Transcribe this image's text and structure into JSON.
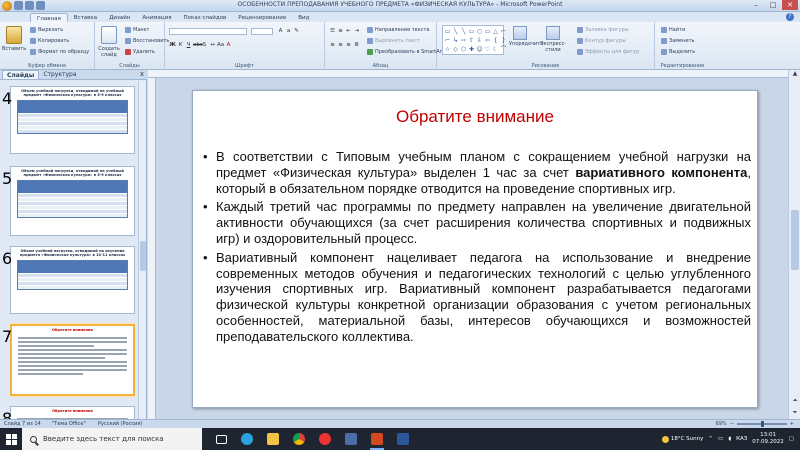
{
  "window": {
    "title": "ОСОБЕННОСТИ ПРЕПОДАВАНИЯ УЧЕБНОГО ПРЕДМЕТА «ФИЗИЧЕСКАЯ КУЛЬТУРА» - Microsoft PowerPoint",
    "minimize": "–",
    "maximize": "□",
    "close": "✕"
  },
  "tabs": [
    "Главная",
    "Вставка",
    "Дизайн",
    "Анимация",
    "Показ слайдов",
    "Рецензирование",
    "Вид"
  ],
  "ribbon": {
    "clipboard": {
      "label": "Буфер обмена",
      "paste": "Вставить",
      "cut": "Вырезать",
      "copy": "Копировать",
      "format": "Формат по образцу"
    },
    "slides": {
      "label": "Слайды",
      "new": "Создать слайд",
      "layout": "Макет",
      "reset": "Восстановить",
      "delete": "Удалить"
    },
    "font": {
      "label": "Шрифт"
    },
    "paragraph": {
      "label": "Абзац",
      "direction": "Направление текста",
      "align": "Выровнять текст",
      "smartart": "Преобразовать в SmartArt"
    },
    "drawing": {
      "label": "Рисование",
      "arrange": "Упорядочить",
      "quickstyles": "Экспресс-стили",
      "fill": "Заливка фигуры",
      "outline": "Контур фигуры",
      "effects": "Эффекты для фигур"
    },
    "editing": {
      "label": "Редактирование",
      "find": "Найти",
      "replace": "Заменить",
      "select": "Выделить"
    }
  },
  "leftpanel": {
    "tab_slides": "Слайды",
    "tab_outline": "Структура",
    "close": "x",
    "thumbs": [
      {
        "num": "4",
        "title": "Объем учебной нагрузки, отводимой на учебный предмет «Физическая культура» в 5-9 классах"
      },
      {
        "num": "5",
        "title": "Объем учебной нагрузки, отводимой на учебный предмет «Физическая культура» в 5-9 классах"
      },
      {
        "num": "6",
        "title": "Объем учебной нагрузки, отводимой на изучение предмета «Физическая культура» в 10-11 классах"
      },
      {
        "num": "7",
        "title": "Обратите внимание"
      },
      {
        "num": "8",
        "title": "Обратите внимание"
      }
    ]
  },
  "slide": {
    "title": "Обратите внимание",
    "bullets": [
      {
        "pre": "В соответствии с Типовым учебным планом с сокращением учебной нагрузки на предмет «Физическая культура» выделен 1 час за счет ",
        "bold": "вариативного компонента",
        "post": ", который в обязательном порядке отводится на проведение спортивных игр."
      },
      {
        "pre": "Каждый третий час программы по предмету направлен на увеличение двигательной активности обучающихся (за счет расширения количества спортивных и подвижных игр) и оздоровительный процесс.",
        "bold": "",
        "post": ""
      },
      {
        "pre": "Вариативный компонент нацеливает педагога на использование и внедрение современных методов обучения и педагогических технологий с целью углубленного изучения спортивных игр. Вариативный компонент разрабатывается педагогами физической культуры конкретной организации образования с учетом региональных особенностей, материальной базы, интересов обучающихся и возможностей преподавательского коллектива.",
        "bold": "",
        "post": ""
      }
    ]
  },
  "status": {
    "slide_info": "Слайд 7 из 14",
    "theme": "\"Тема Office\"",
    "language": "Русский (Россия)",
    "zoom": "69%"
  },
  "taskbar": {
    "search_placeholder": "Введите здесь текст для поиска",
    "weather": "18°C Sunny",
    "lang": "КАЗ",
    "time": "13:01",
    "date": "07.09.2022"
  },
  "colors": {
    "title_red": "#c00000",
    "selected_thumb": "#f2b33d",
    "ribbon_bg": "#dbe6f3"
  }
}
